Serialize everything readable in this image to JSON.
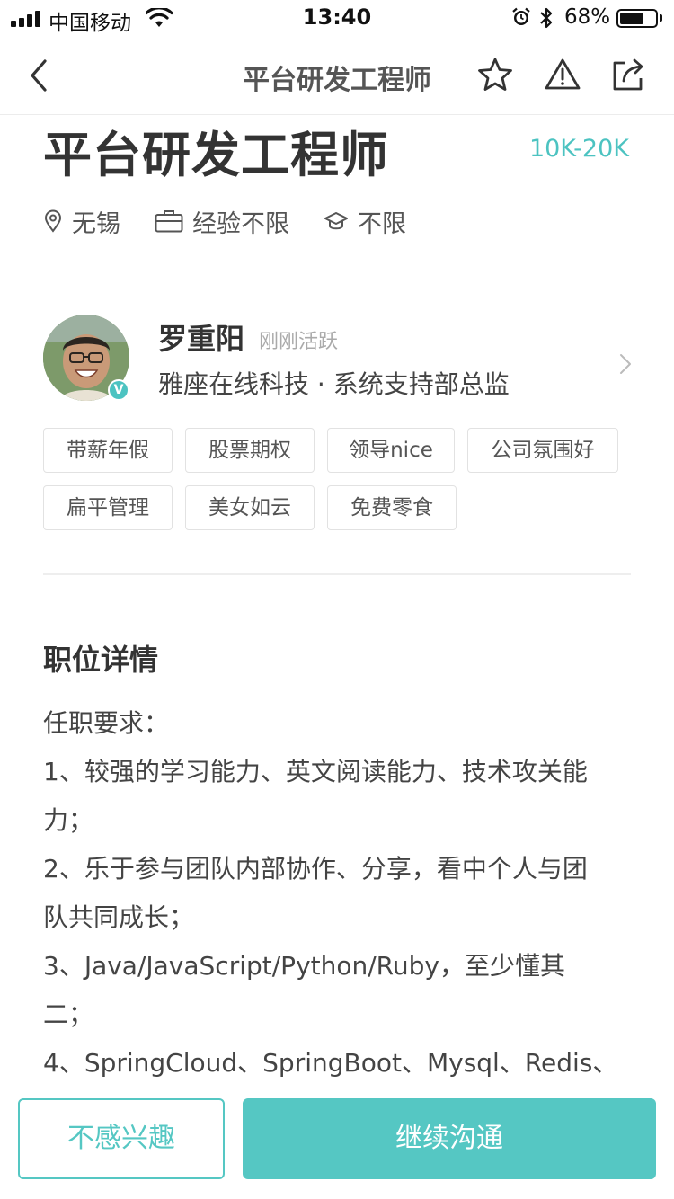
{
  "status_bar": {
    "carrier": "中国移动",
    "time": "13:40",
    "battery_percent_text": "68%",
    "battery_level": 0.68
  },
  "nav": {
    "title": "平台研发工程师",
    "icons": [
      "back-icon",
      "star-icon",
      "warning-icon",
      "share-icon"
    ]
  },
  "job": {
    "title": "平台研发工程师",
    "salary": "10K-20K",
    "city": "无锡",
    "experience": "经验不限",
    "education": "不限"
  },
  "recruiter": {
    "name": "罗重阳",
    "active_status": "刚刚活跃",
    "company_position": "雅座在线科技 · 系统支持部总监",
    "verified_badge": "V"
  },
  "tags": [
    "带薪年假",
    "股票期权",
    "领导nice",
    "公司氛围好",
    "扁平管理",
    "美女如云",
    "免费零食"
  ],
  "details": {
    "section_title": "职位详情",
    "lines": [
      "任职要求：",
      "1、较强的学习能力、英文阅读能力、技术攻关能",
      "力；",
      "2、乐于参与团队内部协作、分享，看中个人与团",
      "队共同成长；",
      "3、Java/JavaScript/Python/Ruby，至少懂其",
      "二；",
      "4、SpringCloud、SpringBoot、Mysql、Redis、"
    ]
  },
  "actions": {
    "not_interested": "不感兴趣",
    "continue_chat": "继续沟通"
  },
  "colors": {
    "accent": "#4cc3c1",
    "button": "#55c7c3",
    "text_primary": "#333333"
  }
}
